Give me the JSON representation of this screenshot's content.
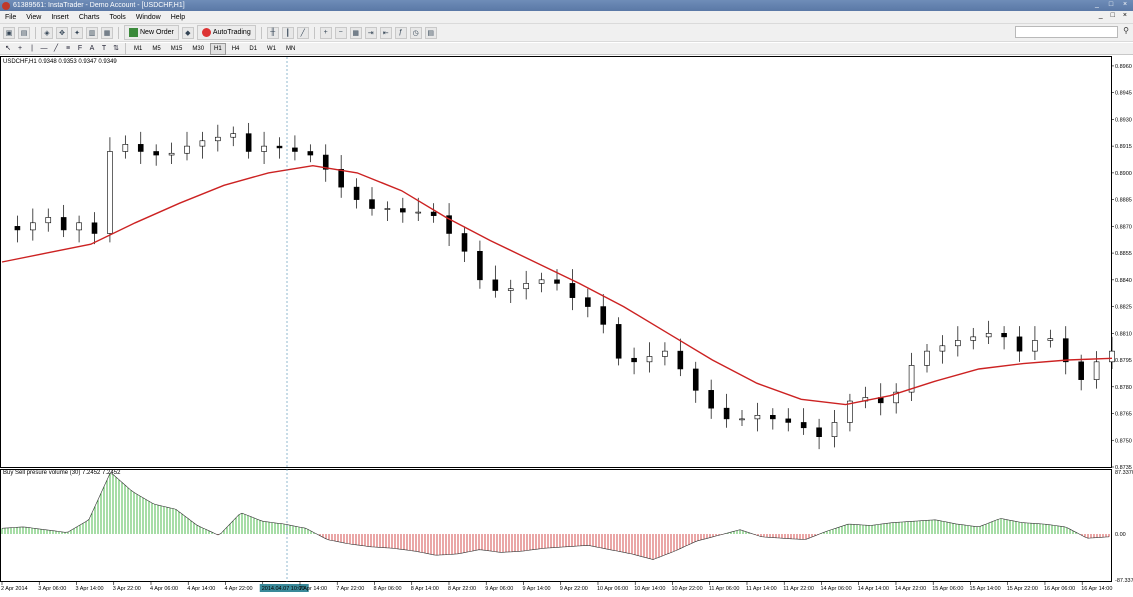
{
  "window": {
    "title": "61389561: InstaTrader - Demo Account - [USDCHF,H1]",
    "controls": [
      "_",
      "□",
      "×"
    ]
  },
  "menu": {
    "items": [
      "File",
      "View",
      "Insert",
      "Charts",
      "Tools",
      "Window",
      "Help"
    ],
    "mdi_controls": [
      "_",
      "□",
      "×"
    ]
  },
  "toolbar": {
    "new_order": "New Order",
    "auto_trading": "AutoTrading",
    "timeframes": [
      "M1",
      "M5",
      "M15",
      "M30",
      "H1",
      "H4",
      "D1",
      "W1",
      "MN"
    ]
  },
  "chart": {
    "header": "USDCHF,H1  0.9348 0.9353 0.9347 0.9349",
    "indicator_header": "Buy Sell presure volume (30) 7.2452 7.2452",
    "price_ticks": [
      "0.8960",
      "0.8945",
      "0.8930",
      "0.8915",
      "0.8900",
      "0.8885",
      "0.8870",
      "0.8855",
      "0.8840",
      "0.8825",
      "0.8810",
      "0.8795",
      "0.8780",
      "0.8765",
      "0.8750",
      "0.8735"
    ],
    "indicator_ticks": [
      "87.3370",
      "0.00",
      "-87.3370"
    ],
    "time_labels": [
      "2 Apr 2014",
      "3 Apr 06:00",
      "3 Apr 14:00",
      "3 Apr 22:00",
      "4 Apr 06:00",
      "4 Apr 14:00",
      "4 Apr 22:00",
      "2014.04.07 10:00",
      "7 Apr 14:00",
      "7 Apr 22:00",
      "8 Apr 06:00",
      "8 Apr 14:00",
      "8 Apr 22:00",
      "9 Apr 06:00",
      "9 Apr 14:00",
      "9 Apr 22:00",
      "10 Apr 06:00",
      "10 Apr 14:00",
      "10 Apr 22:00",
      "11 Apr 06:00",
      "11 Apr 14:00",
      "11 Apr 22:00",
      "14 Apr 06:00",
      "14 Apr 14:00",
      "14 Apr 22:00",
      "15 Apr 06:00",
      "15 Apr 14:00",
      "15 Apr 22:00",
      "16 Apr 06:00",
      "16 Apr 14:00"
    ],
    "colors": {
      "ma": "#cc2222",
      "buy": "#22aa22",
      "sell": "#cc2222",
      "buy_fill": "#b5f0a8",
      "sell_fill": "#f2b0b0"
    }
  },
  "chart_data": {
    "type": "candlestick",
    "ylim": [
      0.8735,
      0.8965
    ],
    "close_path": [
      0.887,
      0.8868,
      0.8872,
      0.8875,
      0.8868,
      0.8872,
      0.8866,
      0.8912,
      0.8916,
      0.8912,
      0.891,
      0.8911,
      0.8915,
      0.8918,
      0.892,
      0.8922,
      0.8912,
      0.8915,
      0.8914,
      0.8912,
      0.891,
      0.8902,
      0.8892,
      0.8885,
      0.888,
      0.888,
      0.8878,
      0.8878,
      0.8876,
      0.8866,
      0.8856,
      0.884,
      0.8834,
      0.8835,
      0.8838,
      0.884,
      0.8838,
      0.883,
      0.8825,
      0.8815,
      0.8796,
      0.8794,
      0.8797,
      0.88,
      0.879,
      0.8778,
      0.8768,
      0.8762,
      0.8762,
      0.8764,
      0.8762,
      0.876,
      0.8757,
      0.8752,
      0.876,
      0.8772,
      0.8774,
      0.8771,
      0.8777,
      0.8792,
      0.88,
      0.8803,
      0.8806,
      0.8808,
      0.881,
      0.8808,
      0.88,
      0.8806,
      0.8807,
      0.8794,
      0.8784,
      0.8794,
      0.88
    ],
    "ma_path": [
      0.885,
      0.8855,
      0.886,
      0.8872,
      0.8883,
      0.8893,
      0.89,
      0.8904,
      0.89,
      0.889,
      0.8875,
      0.8862,
      0.885,
      0.8838,
      0.8825,
      0.881,
      0.8795,
      0.8782,
      0.8773,
      0.877,
      0.8775,
      0.8783,
      0.879,
      0.8793,
      0.8795,
      0.8796
    ],
    "indicator_path": [
      8,
      10,
      6,
      2,
      20,
      87,
      60,
      42,
      35,
      12,
      -2,
      30,
      18,
      14,
      8,
      -8,
      -14,
      -18,
      -20,
      -24,
      -30,
      -28,
      -22,
      -26,
      -24,
      -20,
      -18,
      -16,
      -22,
      -28,
      -36,
      -24,
      -10,
      -2,
      6,
      -4,
      -6,
      -8,
      4,
      14,
      12,
      16,
      18,
      20,
      14,
      10,
      22,
      16,
      14,
      10,
      -6,
      -4
    ]
  }
}
